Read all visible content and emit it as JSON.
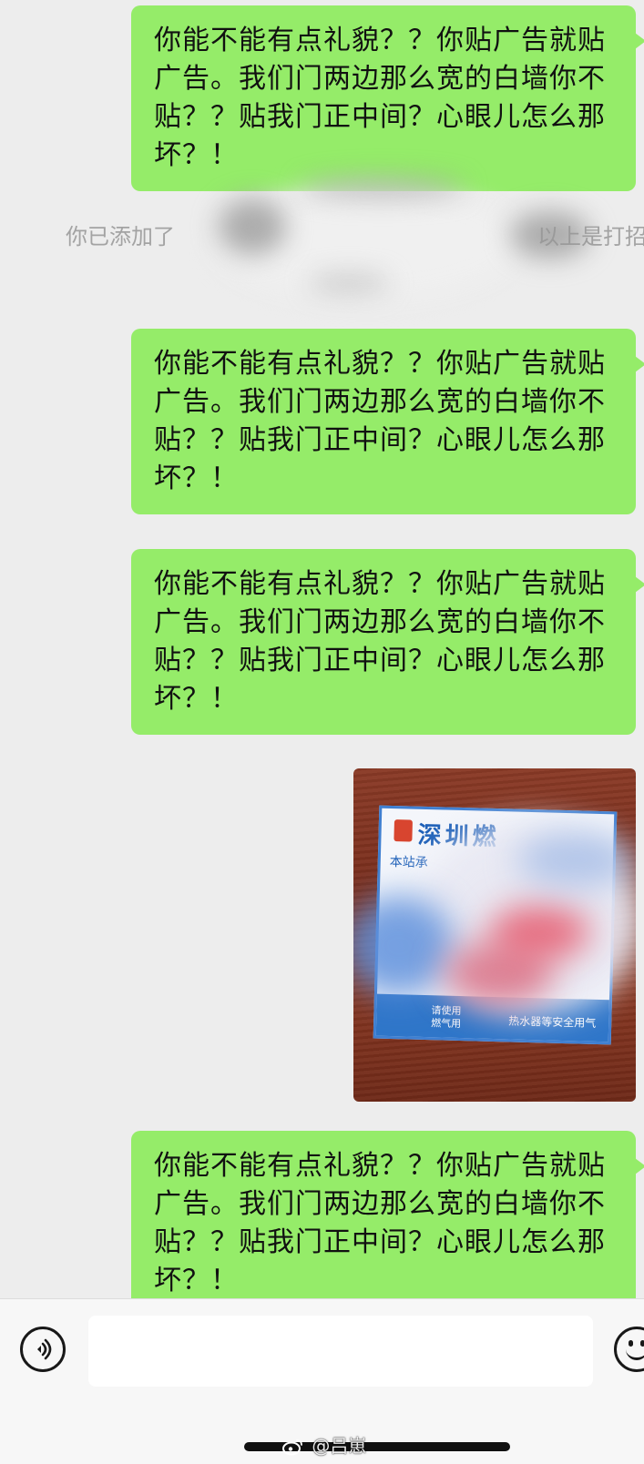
{
  "chat": {
    "messages": [
      {
        "type": "text",
        "sender": "self",
        "text": "你能不能有点礼貌？？你贴广告就贴广告。我们门两边那么宽的白墙你不贴？？贴我门正中间？心眼儿怎么那坏？！"
      },
      {
        "type": "system",
        "text_left": "你已添加了",
        "text_right": "以上是打招"
      },
      {
        "type": "text",
        "sender": "self",
        "text": "你能不能有点礼貌？？你贴广告就贴广告。我们门两边那么宽的白墙你不贴？？贴我门正中间？心眼儿怎么那坏？！"
      },
      {
        "type": "text",
        "sender": "self",
        "text": "你能不能有点礼貌？？你贴广告就贴广告。我们门两边那么宽的白墙你不贴？？贴我门正中间？心眼儿怎么那坏？！"
      },
      {
        "type": "image",
        "sender": "self",
        "content": {
          "sticker_title": "深圳燃",
          "sticker_line": "本站承",
          "sticker_band_left": "请使用\n燃气用",
          "sticker_band_right": "热水器等安全用气"
        }
      },
      {
        "type": "text",
        "sender": "self",
        "text": "你能不能有点礼貌？？你贴广告就贴广告。我们门两边那么宽的白墙你不贴？？贴我门正中间？心眼儿怎么那坏？！"
      }
    ]
  },
  "input_bar": {
    "voice_icon": "voice-icon",
    "input_value": "",
    "emoji_icon": "emoji-icon"
  },
  "watermark": {
    "icon": "weibo-icon",
    "text": "@吕崽"
  },
  "colors": {
    "bubble": "#95ec69",
    "background": "#ededed",
    "system_text": "#a3a3a3",
    "sticker_blue": "#2f76c9"
  }
}
